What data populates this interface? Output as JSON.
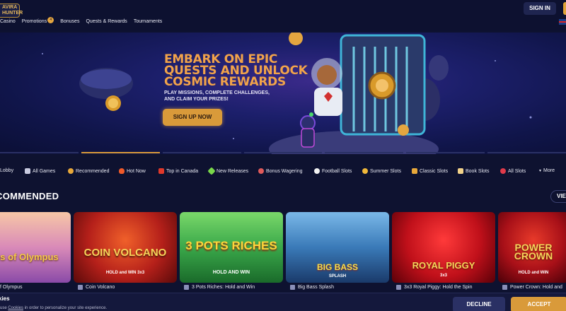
{
  "header": {
    "logo_text": "AVIRA HUNTER",
    "nav": [
      {
        "label": "Casino"
      },
      {
        "label": "Promotions",
        "badge": "4"
      },
      {
        "label": "Bonuses"
      },
      {
        "label": "Quests & Rewards"
      },
      {
        "label": "Tournaments"
      }
    ],
    "signin_label": "SIGN IN",
    "language_icon": "uk-flag-icon"
  },
  "banner": {
    "title": "EMBARK ON EPIC QUESTS AND UNLOCK COSMIC REWARDS",
    "subtitle": "PLAY MISSIONS, COMPLETE CHALLENGES, AND CLAIM YOUR PRIZES!",
    "cta_label": "SIGN UP NOW",
    "slides_total": 7,
    "active_slide": 1
  },
  "categories": [
    {
      "label": "Lobby",
      "icon": "lobby-icon"
    },
    {
      "label": "All Games",
      "icon": "grid-icon"
    },
    {
      "label": "Recommended",
      "icon": "thumbs-up-icon"
    },
    {
      "label": "Hot Now",
      "icon": "fire-icon"
    },
    {
      "label": "Top in Canada",
      "icon": "maple-leaf-icon"
    },
    {
      "label": "New Releases",
      "icon": "sparkle-icon"
    },
    {
      "label": "Bonus Wagering",
      "icon": "gift-icon"
    },
    {
      "label": "Football Slots",
      "icon": "football-icon"
    },
    {
      "label": "Summer Slots",
      "icon": "sun-icon"
    },
    {
      "label": "Classic Slots",
      "icon": "seven-icon"
    },
    {
      "label": "Book Slots",
      "icon": "book-icon"
    },
    {
      "label": "All Slots",
      "icon": "cherry-icon"
    },
    {
      "label": "More",
      "icon": "chevron-down-icon"
    }
  ],
  "section": {
    "title": "COMMENDED",
    "view_label": "VIEW"
  },
  "games": [
    {
      "art_text": "Gates of Olympus",
      "caption": "f Olympus"
    },
    {
      "art_text": "COIN VOLCANO",
      "art_sub": "HOLD and WIN 3x3",
      "caption": "Coin Volcano"
    },
    {
      "art_text": "3 POTS RICHES",
      "art_sub": "HOLD AND WIN",
      "caption": "3 Pots Riches: Hold and Win"
    },
    {
      "art_text": "BIG BASS",
      "art_sub": "SPLASH",
      "caption": "Big Bass Splash"
    },
    {
      "art_text": "ROYAL PIGGY",
      "art_sub": "3x3",
      "caption": "3x3 Royal Piggy: Hold the Spin"
    },
    {
      "art_text": "POWER CROWN",
      "art_sub": "HOLD and WIN",
      "caption": "Power Crown: Hold and"
    }
  ],
  "cookie": {
    "title": "kies",
    "text_before": "use ",
    "link": "Cookies",
    "text_after": " in order to personalize your site experience.",
    "decline_label": "DECLINE",
    "accept_label": "ACCEPT"
  },
  "colors": {
    "background": "#0e1230",
    "accent": "#d99a3a",
    "banner_title": "#f1a34a"
  }
}
